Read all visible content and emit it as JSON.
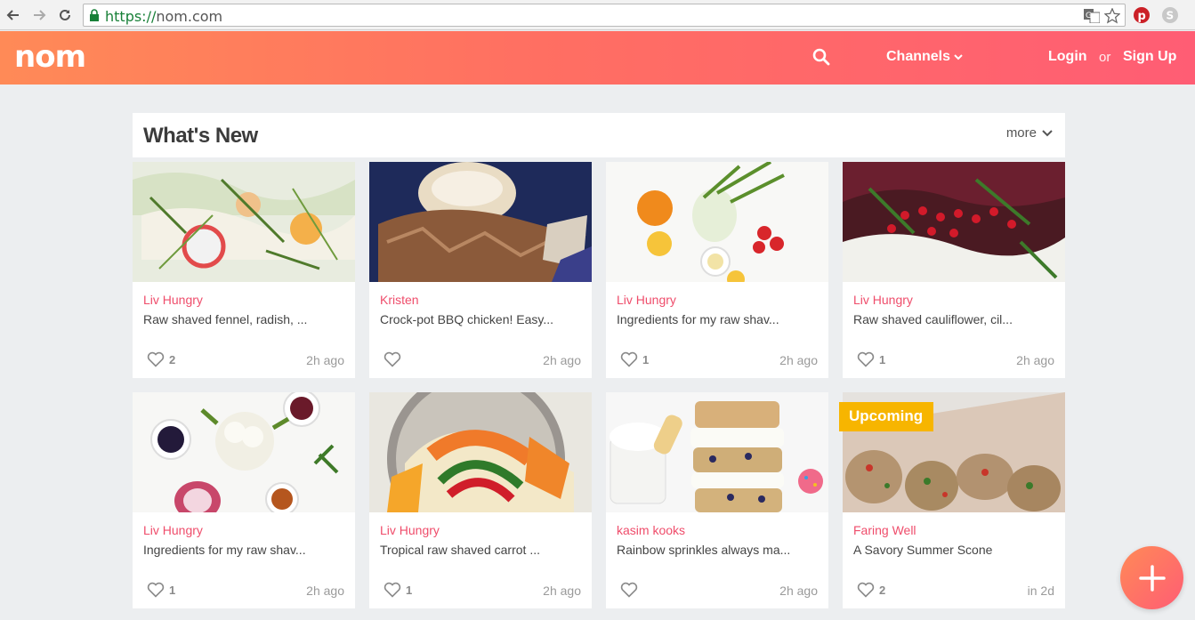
{
  "browser": {
    "url_scheme": "https://",
    "url_host": "nom.com"
  },
  "header": {
    "logo": "nom",
    "channels_label": "Channels",
    "login_label": "Login",
    "or_label": "or",
    "signup_label": "Sign Up"
  },
  "section": {
    "title": "What's New",
    "more_label": "more"
  },
  "cards": [
    {
      "author": "Liv Hungry",
      "desc": "Raw shaved fennel, radish, ...",
      "likes": "2",
      "time": "2h ago",
      "image": "fennel-radish-salad"
    },
    {
      "author": "Kristen",
      "desc": "Crock-pot BBQ chicken! Easy...",
      "likes": "",
      "time": "2h ago",
      "image": "bbq-chicken-bun"
    },
    {
      "author": "Liv Hungry",
      "desc": "Ingredients for my raw shav...",
      "likes": "1",
      "time": "2h ago",
      "image": "fennel-orange-radish-ingredients"
    },
    {
      "author": "Liv Hungry",
      "desc": "Raw shaved cauliflower, cil...",
      "likes": "1",
      "time": "2h ago",
      "image": "pomegranate-beet-salad"
    },
    {
      "author": "Liv Hungry",
      "desc": "Ingredients for my raw shav...",
      "likes": "1",
      "time": "2h ago",
      "image": "cauliflower-onion-ingredients"
    },
    {
      "author": "Liv Hungry",
      "desc": "Tropical raw shaved carrot ...",
      "likes": "1",
      "time": "2h ago",
      "image": "shaved-carrot-bowl"
    },
    {
      "author": "kasim kooks",
      "desc": "Rainbow sprinkles always ma...",
      "likes": "",
      "time": "2h ago",
      "image": "sprinkle-cookie-sandwich"
    },
    {
      "author": "Faring Well",
      "desc": "A Savory Summer Scone",
      "likes": "2",
      "time": "in 2d",
      "image": "savory-scones",
      "badge": "Upcoming"
    }
  ],
  "colors": {
    "brand_start": "#ff8a57",
    "brand_end": "#ff5d74",
    "author": "#ef4d6b",
    "badge": "#f7b500"
  }
}
